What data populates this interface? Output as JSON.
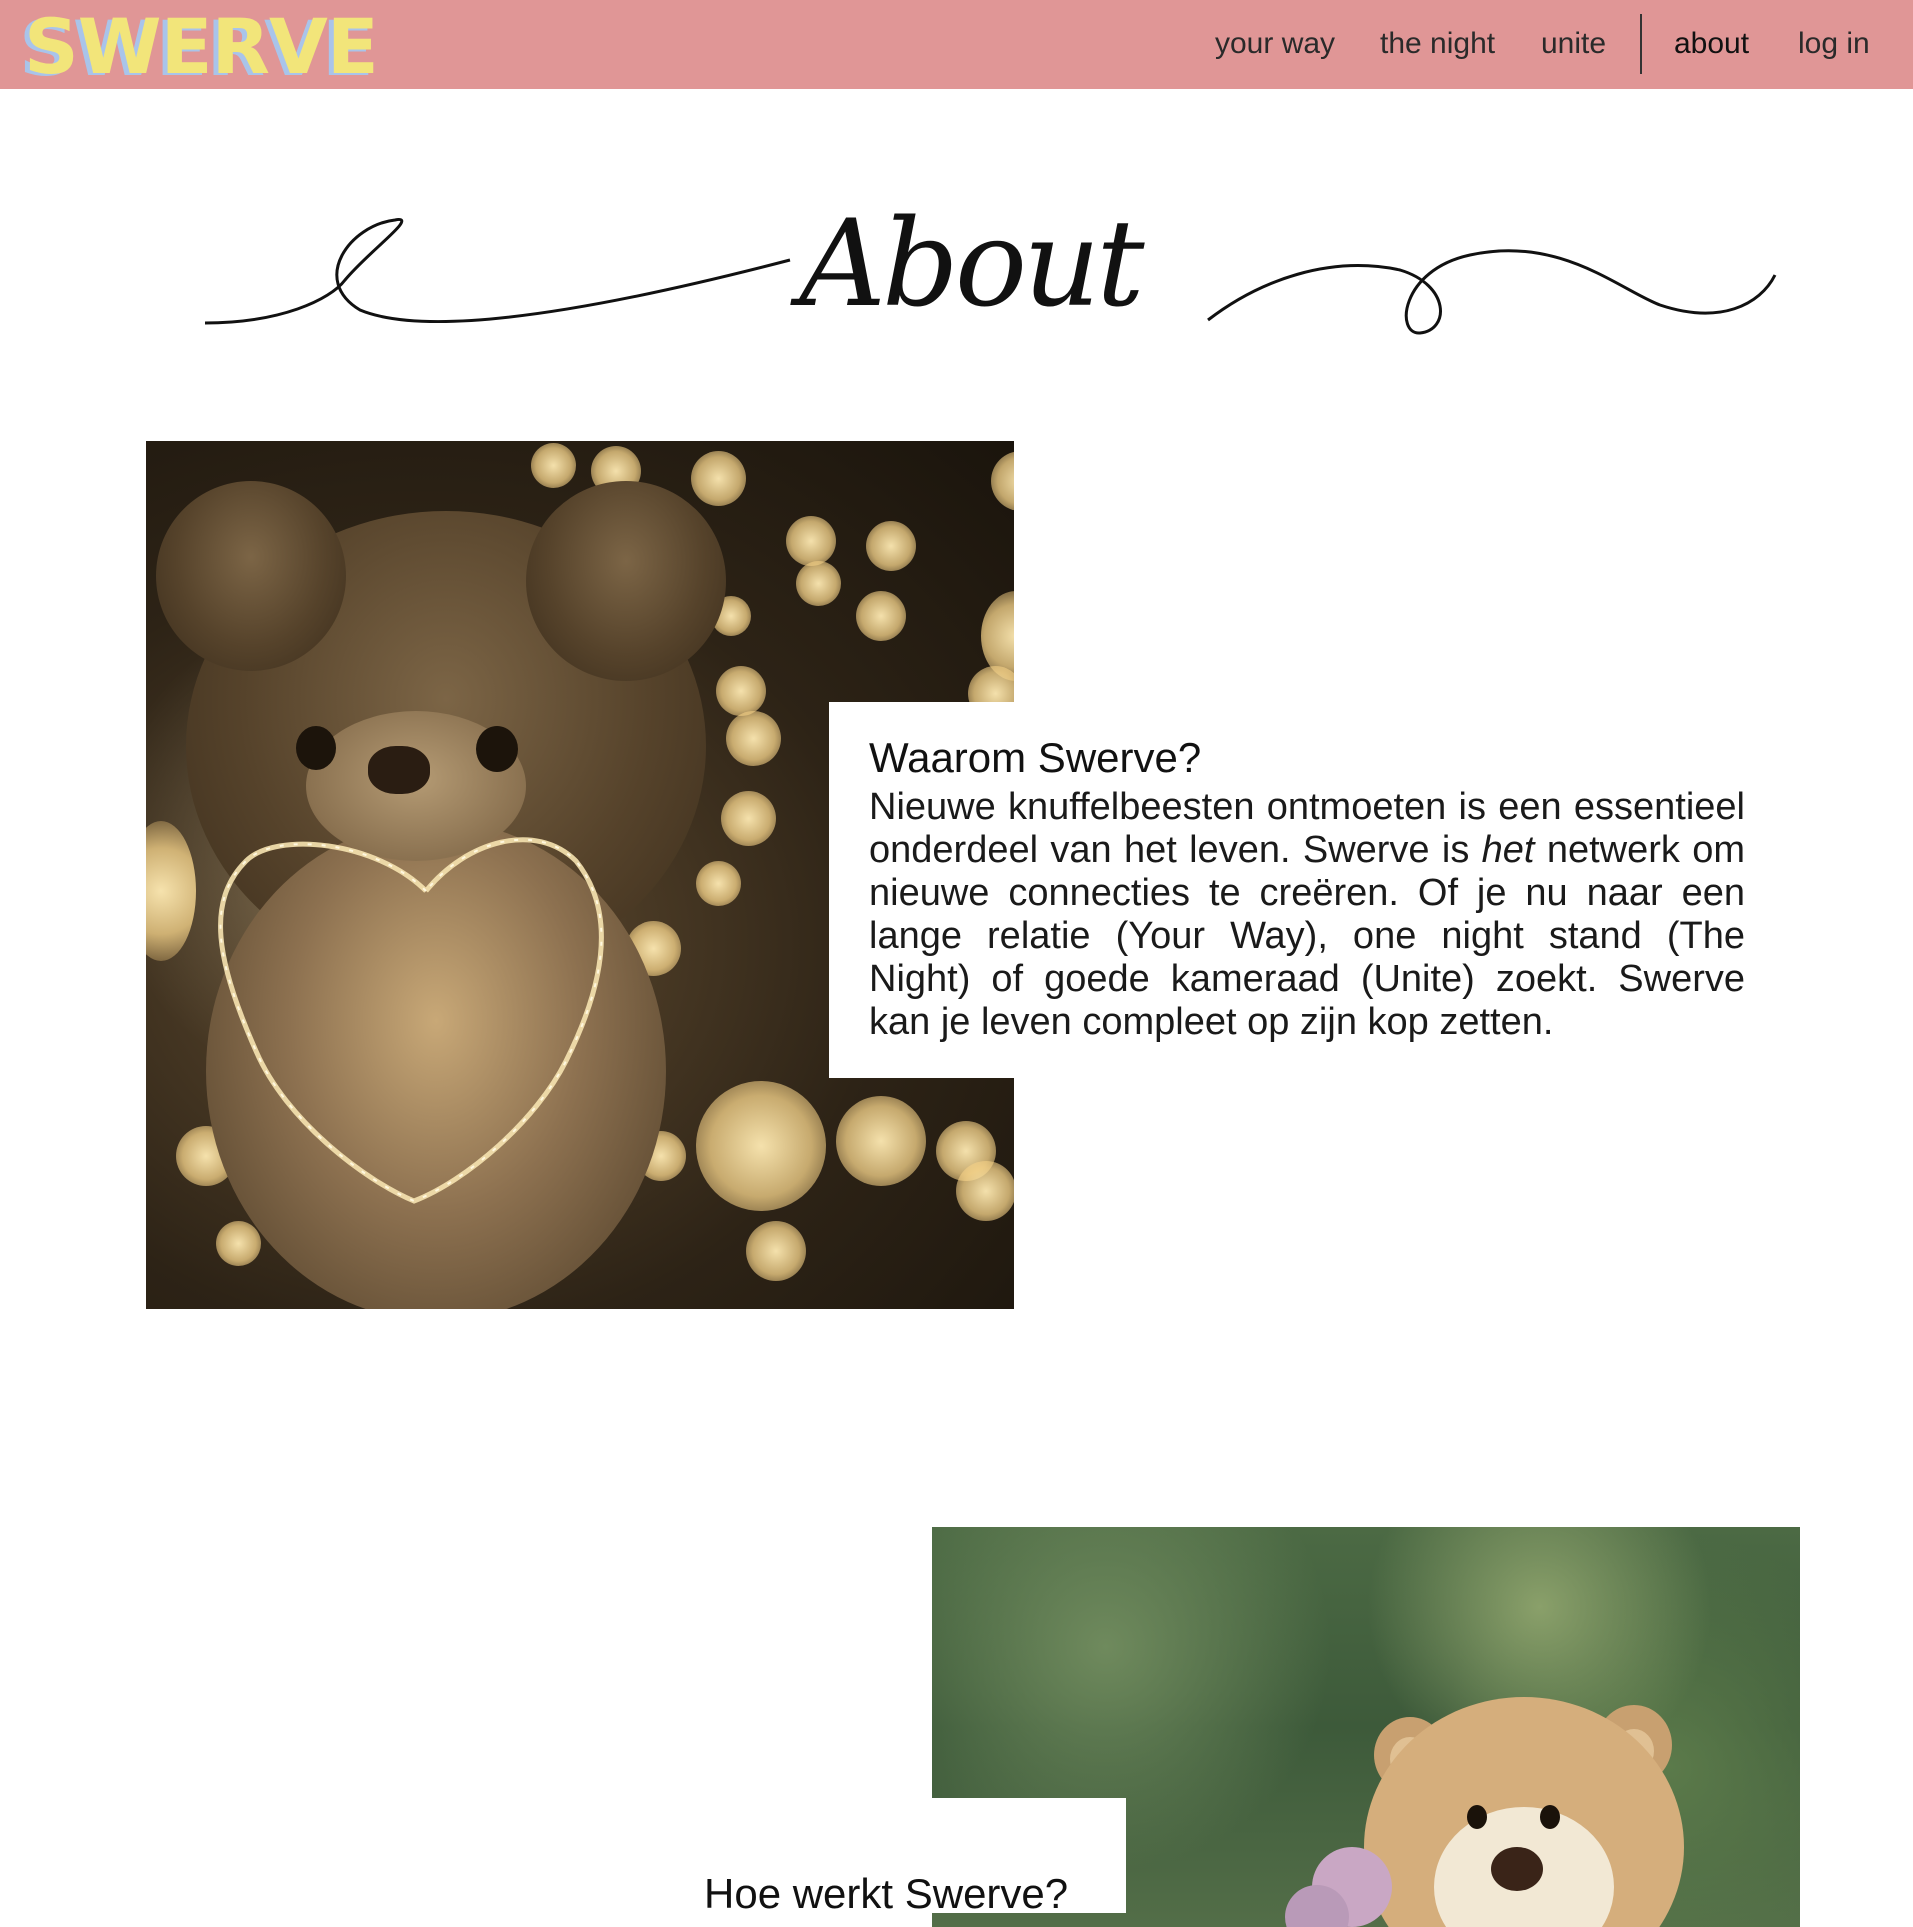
{
  "header": {
    "logo": "SWERVE",
    "nav": {
      "your_way": "your way",
      "the_night": "the night",
      "unite": "unite",
      "about": "about",
      "login": "log in"
    }
  },
  "page": {
    "title": "About"
  },
  "sections": {
    "why": {
      "heading": "Waarom Swerve?",
      "body_part1": "Nieuwe knuffelbeesten ontmoeten is een essentieel onderdeel van het leven. Swerve is ",
      "body_emphasis": "het",
      "body_part2": " netwerk om nieuwe connecties te creëren. Of je nu naar een lange relatie (Your Way), one night stand (The Night) of goede kameraad (Unite) zoekt. Swerve kan je leven compleet op zijn kop zetten."
    },
    "how": {
      "heading": "Hoe werkt Swerve?"
    }
  },
  "colors": {
    "nav_bg": "#e09696",
    "logo_fill": "#f2e57a",
    "logo_shadow": "#a9c4ea"
  }
}
